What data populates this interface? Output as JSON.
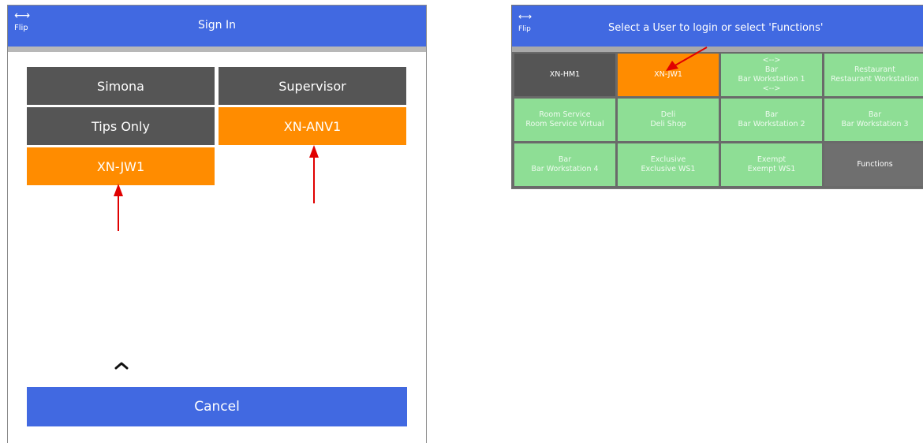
{
  "signin": {
    "flip_icon": "⟷",
    "flip_label": "Flip",
    "title": "Sign In",
    "users": [
      "Simona",
      "Supervisor",
      "Tips Only",
      "XN-ANV1",
      "XN-JW1"
    ],
    "chevron_icon": "chevron-up-icon",
    "cancel_label": "Cancel"
  },
  "select": {
    "flip_icon": "⟷",
    "flip_label": "Flip",
    "title": "Select a User to login or select 'Functions'",
    "tiles": [
      {
        "line1": "XN-HM1",
        "line2": "",
        "line3": "",
        "line4": ""
      },
      {
        "line1": "XN-JW1",
        "line2": "",
        "line3": "",
        "line4": ""
      },
      {
        "line1": "<-->",
        "line2": "Bar",
        "line3": "Bar Workstation 1",
        "line4": "<-->"
      },
      {
        "line1": "Restaurant",
        "line2": "Restaurant Workstation",
        "line3": "",
        "line4": ""
      },
      {
        "line1": "Room Service",
        "line2": "Room Service Virtual",
        "line3": "",
        "line4": ""
      },
      {
        "line1": "Deli",
        "line2": "Deli Shop",
        "line3": "",
        "line4": ""
      },
      {
        "line1": "Bar",
        "line2": "Bar Workstation 2",
        "line3": "",
        "line4": ""
      },
      {
        "line1": "Bar",
        "line2": "Bar Workstation 3",
        "line3": "",
        "line4": ""
      },
      {
        "line1": "Bar",
        "line2": "Bar Workstation 4",
        "line3": "",
        "line4": ""
      },
      {
        "line1": "Exclusive",
        "line2": "Exclusive WS1",
        "line3": "",
        "line4": ""
      },
      {
        "line1": "Exempt",
        "line2": "Exempt WS1",
        "line3": "",
        "line4": ""
      },
      {
        "line1": "Functions",
        "line2": "",
        "line3": "",
        "line4": ""
      }
    ]
  },
  "colors": {
    "header_blue": "#4169e1",
    "tile_dark": "#555555",
    "tile_orange": "#ff8c00",
    "tile_green": "#8ede95",
    "annotation_arrow": "#e00000"
  }
}
